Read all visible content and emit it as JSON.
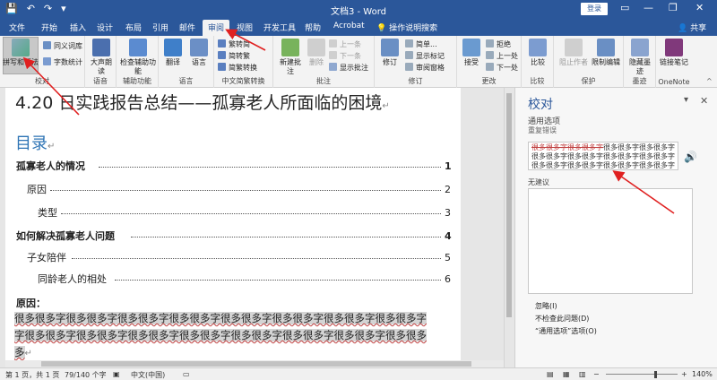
{
  "titlebar": {
    "doc_title": "文档3 - Word",
    "login": "登录",
    "save_glyph": "💾",
    "undo_glyph": "↶",
    "redo_glyph": "↷",
    "customize_glyph": "▾",
    "minimize": "—",
    "restore": "❐",
    "close": "✕",
    "ribbon_opts": "▭"
  },
  "tabs": [
    "文件",
    "开始",
    "插入",
    "设计",
    "布局",
    "引用",
    "邮件",
    "审阅",
    "视图",
    "开发工具",
    "帮助",
    "Acrobat"
  ],
  "active_tab": "审阅",
  "tell_me": "操作说明搜索",
  "share": "共享",
  "ribbon": {
    "proofing": {
      "spelling": "拼写和语法",
      "thesaurus": "同义词库",
      "wordcount": "字数统计",
      "label": "校对"
    },
    "speech": {
      "read_aloud": "大声朗读",
      "label": "语音"
    },
    "accessibility": {
      "check": "检查辅助功能",
      "label": "辅助功能"
    },
    "language": {
      "translate": "翻译",
      "language": "语言",
      "label": "语言"
    },
    "chinese_convert": {
      "to_trad": "繁转简",
      "to_simp": "简转繁",
      "convert": "简繁转换",
      "label": "中文简繁转换"
    },
    "comments": {
      "new": "新建批注",
      "delete": "删除",
      "prev": "上一条",
      "next": "下一条",
      "show": "显示批注",
      "label": "批注"
    },
    "tracking": {
      "track": "修订",
      "simple": "简单...",
      "show_markup": "显示标记",
      "pane": "审阅窗格",
      "label": "修订"
    },
    "changes": {
      "accept": "接受",
      "reject": "拒绝",
      "prev": "上一处",
      "next": "下一处",
      "label": "更改"
    },
    "compare": {
      "compare": "比较",
      "label": "比较"
    },
    "protect": {
      "block": "阻止作者",
      "restrict": "限制编辑",
      "label": "保护"
    },
    "ink": {
      "hide": "隐藏墨迹",
      "label": "墨迹"
    },
    "onenote": {
      "linked": "链接笔记",
      "label": "OneNote"
    }
  },
  "document": {
    "heading": "4.20 日实践报告总结——孤寡老人所面临的困境",
    "toc_title": "目录",
    "toc": [
      {
        "text": "孤寡老人的情况",
        "page": "1",
        "level": 1
      },
      {
        "text": "原因",
        "page": "2",
        "level": 2
      },
      {
        "text": "类型",
        "page": "3",
        "level": 3
      },
      {
        "text": "如何解决孤寡老人问题",
        "page": "4",
        "level": 1
      },
      {
        "text": "子女陪伴",
        "page": "5",
        "level": 2
      },
      {
        "text": "同龄老人的相处",
        "page": "6",
        "level": 3
      }
    ],
    "reason_label": "原因：",
    "reason_line1": "很多很多字很多很多字很多很多字很多很多字很多很多字很多很多字很多很多字很多很多字",
    "reason_line2": "字很多很多字很多很多字很多很多字很多很多字很多很多字很多很多字很多很多字很多很多",
    "reason_line3": "多",
    "para_mark": "↵"
  },
  "pane": {
    "title": "校对",
    "section": "通用选项",
    "error_type": "重复错误",
    "error_strike": "很多很多字很多很多字",
    "error_text": "很多很多字很多很多字很多很多字很多很多字很多很多字很多很多字很多很多字很多很多字很多很多字很多很多字很多很多字很多很多字很多很多字很多很多字",
    "no_suggestions": "无建议",
    "ignore": "忽略(I)",
    "dont_check": "不检查此问题(D)",
    "options": "“通用选项”选项(O)"
  },
  "status": {
    "page": "第 1 页，共 1 页",
    "words": "79/140 个字",
    "lang": "中文(中国)",
    "zoom": "140%"
  },
  "colors": {
    "brand": "#2b579a",
    "toc_blue": "#2e74b5",
    "arrow_red": "#e02020"
  }
}
